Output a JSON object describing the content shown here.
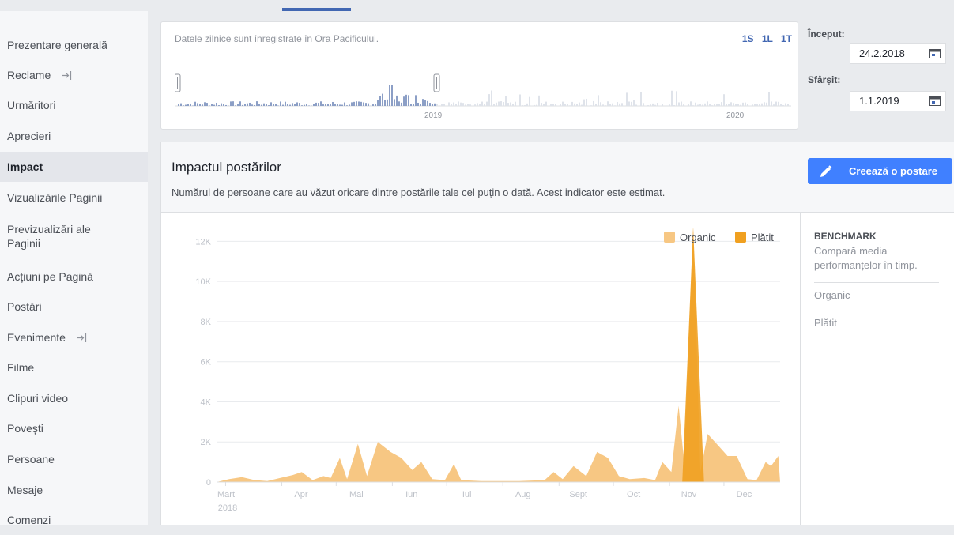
{
  "sidebar": {
    "items": [
      {
        "label": "Prezentare generală"
      },
      {
        "label": "Reclame"
      },
      {
        "label": "Urmăritori"
      },
      {
        "label": "Aprecieri"
      },
      {
        "label": "Impact"
      },
      {
        "label": "Vizualizările Paginii"
      },
      {
        "label": "Previzualizări ale Paginii"
      },
      {
        "label": "Acțiuni pe Pagină"
      },
      {
        "label": "Postări"
      },
      {
        "label": "Evenimente"
      },
      {
        "label": "Filme"
      },
      {
        "label": "Clipuri video"
      },
      {
        "label": "Povești"
      },
      {
        "label": "Persoane"
      },
      {
        "label": "Mesaje"
      },
      {
        "label": "Comenzi"
      }
    ],
    "active": "Impact",
    "accent": "#4267b2"
  },
  "filter": {
    "note": "Datele zilnice sunt înregistrate în Ora Pacificului.",
    "ranges": [
      "1S",
      "1L",
      "1T"
    ],
    "years": [
      "2019",
      "2020"
    ]
  },
  "dates": {
    "start_label": "Început:",
    "start_value": "24.2.2018",
    "end_label": "Sfârșit:",
    "end_value": "1.1.2019"
  },
  "main": {
    "title": "Impactul postărilor",
    "subtitle": "Numărul de persoane care au văzut oricare dintre postările tale cel puțin o dată. Acest indicator este estimat.",
    "create_button": "Creează o postare",
    "button_color": "#4080ff"
  },
  "benchmark": {
    "title": "BENCHMARK",
    "description": "Compară media performanțelor în timp.",
    "items": [
      "Organic",
      "Plătit"
    ]
  },
  "chart_data": {
    "type": "area",
    "legend": [
      {
        "name": "Organic",
        "color": "#f7c783"
      },
      {
        "name": "Plătit",
        "color": "#f0a020"
      }
    ],
    "legend_position": "top-right",
    "y_ticks": [
      "0",
      "2K",
      "4K",
      "6K",
      "8K",
      "10K",
      "12K"
    ],
    "ylim": [
      0,
      13000
    ],
    "x_ticks": [
      "Mart",
      "Apr",
      "Mai",
      "Iun",
      "Iul",
      "Aug",
      "Sept",
      "Oct",
      "Nov",
      "Dec"
    ],
    "x_year": "2018",
    "grid": true,
    "series": [
      {
        "name": "Organic",
        "color": "#f7c783",
        "points": [
          [
            "2018-02-24",
            0
          ],
          [
            "2018-03-03",
            150
          ],
          [
            "2018-03-10",
            250
          ],
          [
            "2018-03-17",
            100
          ],
          [
            "2018-03-24",
            50
          ],
          [
            "2018-03-31",
            200
          ],
          [
            "2018-04-07",
            350
          ],
          [
            "2018-04-12",
            500
          ],
          [
            "2018-04-18",
            100
          ],
          [
            "2018-04-24",
            300
          ],
          [
            "2018-04-28",
            200
          ],
          [
            "2018-05-03",
            1200
          ],
          [
            "2018-05-07",
            150
          ],
          [
            "2018-05-13",
            1900
          ],
          [
            "2018-05-18",
            300
          ],
          [
            "2018-05-24",
            2000
          ],
          [
            "2018-05-31",
            1500
          ],
          [
            "2018-06-06",
            1200
          ],
          [
            "2018-06-12",
            600
          ],
          [
            "2018-06-17",
            1000
          ],
          [
            "2018-06-23",
            150
          ],
          [
            "2018-06-30",
            100
          ],
          [
            "2018-07-05",
            900
          ],
          [
            "2018-07-09",
            100
          ],
          [
            "2018-07-20",
            50
          ],
          [
            "2018-08-10",
            50
          ],
          [
            "2018-08-24",
            100
          ],
          [
            "2018-08-29",
            500
          ],
          [
            "2018-09-03",
            150
          ],
          [
            "2018-09-09",
            800
          ],
          [
            "2018-09-16",
            300
          ],
          [
            "2018-09-22",
            1500
          ],
          [
            "2018-09-28",
            1200
          ],
          [
            "2018-10-04",
            300
          ],
          [
            "2018-10-10",
            150
          ],
          [
            "2018-10-18",
            200
          ],
          [
            "2018-10-24",
            100
          ],
          [
            "2018-10-28",
            1000
          ],
          [
            "2018-11-02",
            500
          ],
          [
            "2018-11-06",
            3800
          ],
          [
            "2018-11-09",
            1000
          ],
          [
            "2018-11-14",
            12700
          ],
          [
            "2018-11-18",
            500
          ],
          [
            "2018-11-22",
            2400
          ],
          [
            "2018-11-28",
            1800
          ],
          [
            "2018-12-03",
            1300
          ],
          [
            "2018-12-08",
            1300
          ],
          [
            "2018-12-14",
            150
          ],
          [
            "2018-12-19",
            100
          ],
          [
            "2018-12-24",
            1000
          ],
          [
            "2018-12-27",
            800
          ],
          [
            "2018-12-31",
            1300
          ],
          [
            "2019-01-01",
            0
          ]
        ]
      },
      {
        "name": "Plătit",
        "color": "#f0a020",
        "points": [
          [
            "2018-02-24",
            0
          ],
          [
            "2018-11-08",
            0
          ],
          [
            "2018-11-14",
            12700
          ],
          [
            "2018-11-20",
            0
          ],
          [
            "2019-01-01",
            0
          ]
        ]
      }
    ]
  }
}
